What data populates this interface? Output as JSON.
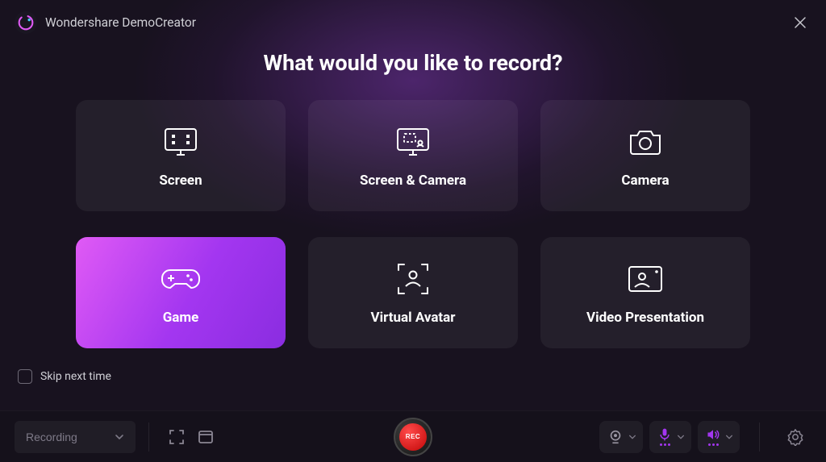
{
  "app": {
    "title": "Wondershare DemoCreator"
  },
  "heading": "What would you like to record?",
  "cards": [
    {
      "label": "Screen",
      "icon": "screen",
      "active": false
    },
    {
      "label": "Screen & Camera",
      "icon": "screen-camera",
      "active": false
    },
    {
      "label": "Camera",
      "icon": "camera",
      "active": false
    },
    {
      "label": "Game",
      "icon": "game",
      "active": true
    },
    {
      "label": "Virtual Avatar",
      "icon": "avatar",
      "active": false
    },
    {
      "label": "Video Presentation",
      "icon": "presentation",
      "active": false
    }
  ],
  "skip": {
    "label": "Skip next time",
    "checked": false
  },
  "bottombar": {
    "recording_dropdown": "Recording",
    "rec_label": "REC"
  },
  "colors": {
    "accent": "#a336f0"
  }
}
